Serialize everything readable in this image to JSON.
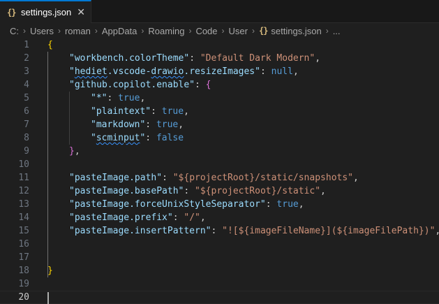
{
  "tab": {
    "icon": "{}",
    "label": "settings.json",
    "close": "✕"
  },
  "breadcrumb": {
    "items": [
      "C:",
      "Users",
      "roman",
      "AppData",
      "Roaming",
      "Code",
      "User"
    ],
    "file_icon": "{}",
    "file": "settings.json",
    "more": "..."
  },
  "editor": {
    "lines": [
      {
        "num": "1",
        "indent": 0,
        "tokens": [
          {
            "t": "{",
            "c": "br1"
          }
        ]
      },
      {
        "num": "2",
        "indent": 1,
        "tokens": [
          {
            "t": "\"workbench.colorTheme\"",
            "c": "key"
          },
          {
            "t": ": ",
            "c": "pun"
          },
          {
            "t": "\"Default Dark Modern\"",
            "c": "str"
          },
          {
            "t": ",",
            "c": "pun"
          }
        ]
      },
      {
        "num": "3",
        "indent": 1,
        "tokens": [
          {
            "t": "\"",
            "c": "key"
          },
          {
            "t": "hediet",
            "c": "key squig"
          },
          {
            "t": ".",
            "c": "key"
          },
          {
            "t": "vscode",
            "c": "key"
          },
          {
            "t": "-",
            "c": "key"
          },
          {
            "t": "drawio",
            "c": "key squig"
          },
          {
            "t": ".resizeImages\"",
            "c": "key"
          },
          {
            "t": ": ",
            "c": "pun"
          },
          {
            "t": "null",
            "c": "kw"
          },
          {
            "t": ",",
            "c": "pun"
          }
        ]
      },
      {
        "num": "4",
        "indent": 1,
        "tokens": [
          {
            "t": "\"github.copilot.enable\"",
            "c": "key"
          },
          {
            "t": ": ",
            "c": "pun"
          },
          {
            "t": "{",
            "c": "br2"
          }
        ]
      },
      {
        "num": "5",
        "indent": 2,
        "tokens": [
          {
            "t": "\"*\"",
            "c": "key"
          },
          {
            "t": ": ",
            "c": "pun"
          },
          {
            "t": "true",
            "c": "kw"
          },
          {
            "t": ",",
            "c": "pun"
          }
        ]
      },
      {
        "num": "6",
        "indent": 2,
        "tokens": [
          {
            "t": "\"plaintext\"",
            "c": "key"
          },
          {
            "t": ": ",
            "c": "pun"
          },
          {
            "t": "true",
            "c": "kw"
          },
          {
            "t": ",",
            "c": "pun"
          }
        ]
      },
      {
        "num": "7",
        "indent": 2,
        "tokens": [
          {
            "t": "\"markdown\"",
            "c": "key"
          },
          {
            "t": ": ",
            "c": "pun"
          },
          {
            "t": "true",
            "c": "kw"
          },
          {
            "t": ",",
            "c": "pun"
          }
        ]
      },
      {
        "num": "8",
        "indent": 2,
        "tokens": [
          {
            "t": "\"",
            "c": "key"
          },
          {
            "t": "scminput",
            "c": "key squig"
          },
          {
            "t": "\"",
            "c": "key"
          },
          {
            "t": ": ",
            "c": "pun"
          },
          {
            "t": "false",
            "c": "kw"
          }
        ]
      },
      {
        "num": "9",
        "indent": 1,
        "tokens": [
          {
            "t": "}",
            "c": "br2"
          },
          {
            "t": ",",
            "c": "pun"
          }
        ]
      },
      {
        "num": "10",
        "indent": 0,
        "tokens": []
      },
      {
        "num": "11",
        "indent": 1,
        "tokens": [
          {
            "t": "\"pasteImage.path\"",
            "c": "key"
          },
          {
            "t": ": ",
            "c": "pun"
          },
          {
            "t": "\"${projectRoot}/static/snapshots\"",
            "c": "str"
          },
          {
            "t": ",",
            "c": "pun"
          }
        ]
      },
      {
        "num": "12",
        "indent": 1,
        "tokens": [
          {
            "t": "\"pasteImage.basePath\"",
            "c": "key"
          },
          {
            "t": ": ",
            "c": "pun"
          },
          {
            "t": "\"${projectRoot}/static\"",
            "c": "str"
          },
          {
            "t": ",",
            "c": "pun"
          }
        ]
      },
      {
        "num": "13",
        "indent": 1,
        "tokens": [
          {
            "t": "\"pasteImage.forceUnixStyleSeparator\"",
            "c": "key"
          },
          {
            "t": ": ",
            "c": "pun"
          },
          {
            "t": "true",
            "c": "kw"
          },
          {
            "t": ",",
            "c": "pun"
          }
        ]
      },
      {
        "num": "14",
        "indent": 1,
        "tokens": [
          {
            "t": "\"pasteImage.prefix\"",
            "c": "key"
          },
          {
            "t": ": ",
            "c": "pun"
          },
          {
            "t": "\"/\"",
            "c": "str"
          },
          {
            "t": ",",
            "c": "pun"
          }
        ]
      },
      {
        "num": "15",
        "indent": 1,
        "tokens": [
          {
            "t": "\"pasteImage.insertPattern\"",
            "c": "key"
          },
          {
            "t": ": ",
            "c": "pun"
          },
          {
            "t": "\"![${imageFileName}](${imageFilePath})\"",
            "c": "str"
          },
          {
            "t": ",",
            "c": "pun"
          }
        ]
      },
      {
        "num": "16",
        "indent": 0,
        "tokens": []
      },
      {
        "num": "17",
        "indent": 0,
        "tokens": []
      },
      {
        "num": "18",
        "indent": 0,
        "tokens": [
          {
            "t": "}",
            "c": "br1"
          }
        ]
      },
      {
        "num": "19",
        "indent": 0,
        "tokens": []
      },
      {
        "num": "20",
        "indent": 0,
        "tokens": [],
        "current": true
      }
    ]
  },
  "colors": {
    "accent": "#0078d4",
    "background": "#1f1f1f",
    "json_key": "#9cdcfe",
    "json_string": "#ce9178",
    "json_keyword": "#569cd6"
  }
}
